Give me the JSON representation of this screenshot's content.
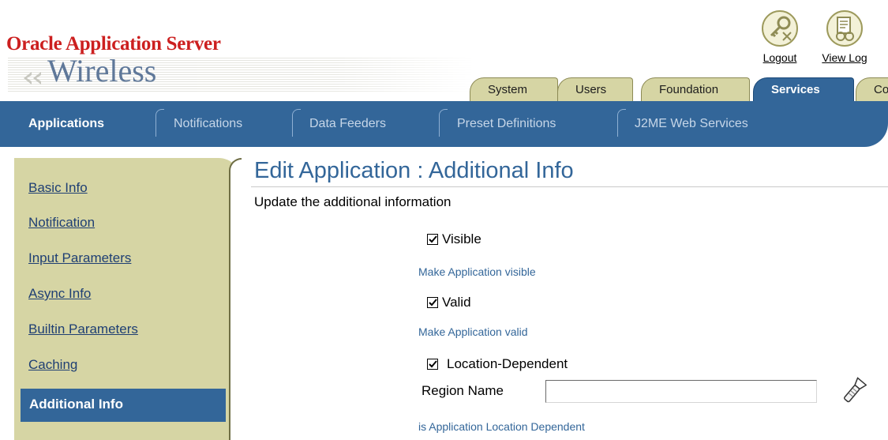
{
  "branding": {
    "company": "Oracle Application Server",
    "product": "Wireless"
  },
  "global_buttons": [
    {
      "label": "Logout",
      "icon": "logout-key-icon"
    },
    {
      "label": "View Log",
      "icon": "view-log-icon"
    }
  ],
  "tabs": [
    {
      "label": "System",
      "active": false
    },
    {
      "label": "Users",
      "active": false
    },
    {
      "label": "Foundation",
      "active": false
    },
    {
      "label": "Services",
      "active": true
    },
    {
      "label": "Co",
      "active": false
    }
  ],
  "subtabs": [
    {
      "label": "Applications",
      "active": true
    },
    {
      "label": "Notifications",
      "active": false
    },
    {
      "label": "Data Feeders",
      "active": false
    },
    {
      "label": "Preset Definitions",
      "active": false
    },
    {
      "label": "J2ME Web Services",
      "active": false
    }
  ],
  "sidenav": [
    {
      "label": "Basic Info"
    },
    {
      "label": "Notification"
    },
    {
      "label": "Input Parameters"
    },
    {
      "label": "Async Info"
    },
    {
      "label": "Builtin Parameters"
    },
    {
      "label": "Caching"
    },
    {
      "label": "Additional Info",
      "active": true
    }
  ],
  "page": {
    "title": "Edit Application : Additional Info",
    "description": "Update the additional information"
  },
  "form": {
    "visible": {
      "label": "Visible",
      "checked": true,
      "tip": "Make Application visible"
    },
    "valid": {
      "label": "Valid",
      "checked": true,
      "tip": "Make Application valid"
    },
    "location_dependent": {
      "label": "Location-Dependent",
      "checked": true
    },
    "region_name": {
      "label": "Region Name",
      "value": "",
      "tip": "is Application Location Dependent",
      "search_icon": "flashlight-icon"
    }
  },
  "colors": {
    "brand_red": "#cc1f1f",
    "nav_blue": "#336699",
    "tab_tan": "#d6d5a4",
    "link_blue": "#1f3f73"
  }
}
